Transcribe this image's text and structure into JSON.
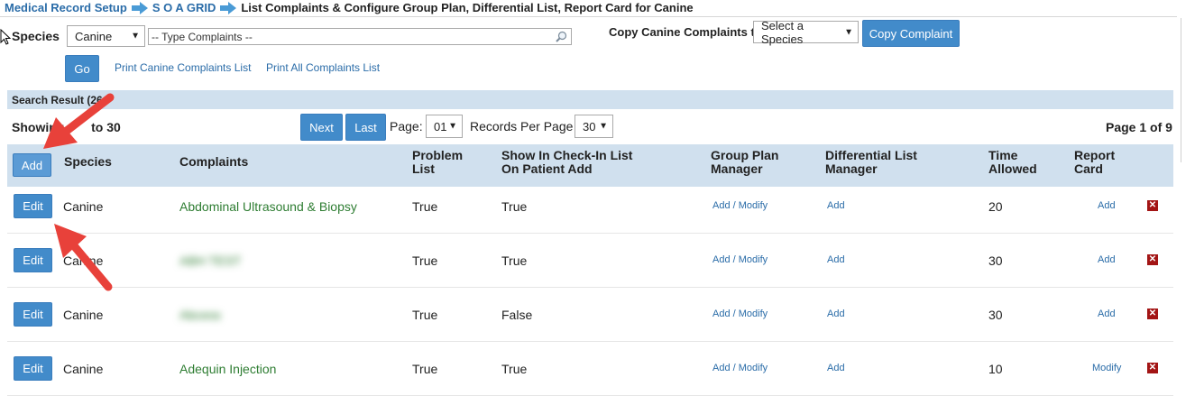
{
  "breadcrumb": {
    "item1": "Medical Record Setup",
    "item2": "S O A GRID",
    "current": "List Complaints & Configure Group Plan, Differential List, Report Card for Canine"
  },
  "filter": {
    "species_label": "Species",
    "species_value": "Canine",
    "complaint_placeholder": "-- Type Complaints --",
    "copy_label": "Copy Canine Complaints to",
    "copy_select_value": "Select a Species",
    "copy_button": "Copy Complaint",
    "go_button": "Go",
    "print_canine_link": "Print Canine Complaints List",
    "print_all_link": "Print All Complaints List"
  },
  "results": {
    "search_result_label": "Search Result (26",
    "showing_prefix": "Showing",
    "showing_suffix": "to 30",
    "next_button": "Next",
    "last_button": "Last",
    "page_label": "Page:",
    "page_value": "01",
    "records_label": "Records Per Page",
    "records_value": "30",
    "page_of": "Page 1 of 9"
  },
  "table": {
    "add_button": "Add",
    "headers": {
      "species": "Species",
      "complaints": "Complaints",
      "problem_list_1": "Problem",
      "problem_list_2": "List",
      "show_checkin_1": "Show In Check-In List",
      "show_checkin_2": "On Patient Add",
      "group_plan_1": "Group Plan",
      "group_plan_2": "Manager",
      "differential_1": "Differential List",
      "differential_2": "Manager",
      "time_1": "Time",
      "time_2": "Allowed",
      "report_1": "Report",
      "report_2": "Card"
    },
    "rows": [
      {
        "edit": "Edit",
        "species": "Canine",
        "complaint": "Abdominal Ultrasound & Biopsy",
        "problem": "True",
        "show": "True",
        "group": "Add / Modify",
        "diff": "Add",
        "time": "20",
        "report": "Add",
        "blurred": false
      },
      {
        "edit": "Edit",
        "species": "Canine",
        "complaint": "ABH TEST",
        "problem": "True",
        "show": "True",
        "group": "Add / Modify",
        "diff": "Add",
        "time": "30",
        "report": "Add",
        "blurred": true
      },
      {
        "edit": "Edit",
        "species": "Canine",
        "complaint": "Abcess",
        "problem": "True",
        "show": "False",
        "group": "Add / Modify",
        "diff": "Add",
        "time": "30",
        "report": "Add",
        "blurred": true
      },
      {
        "edit": "Edit",
        "species": "Canine",
        "complaint": "Adequin Injection",
        "problem": "True",
        "show": "True",
        "group": "Add / Modify",
        "diff": "Add",
        "time": "10",
        "report": "Modify",
        "blurred": false
      }
    ],
    "delete_icon": "close-icon"
  },
  "colors": {
    "accent": "#428bca",
    "header_bg": "#d0e0ee",
    "complaint_green": "#2e7d32",
    "delete_red": "#a31515",
    "annotation_red": "#e8413a"
  }
}
